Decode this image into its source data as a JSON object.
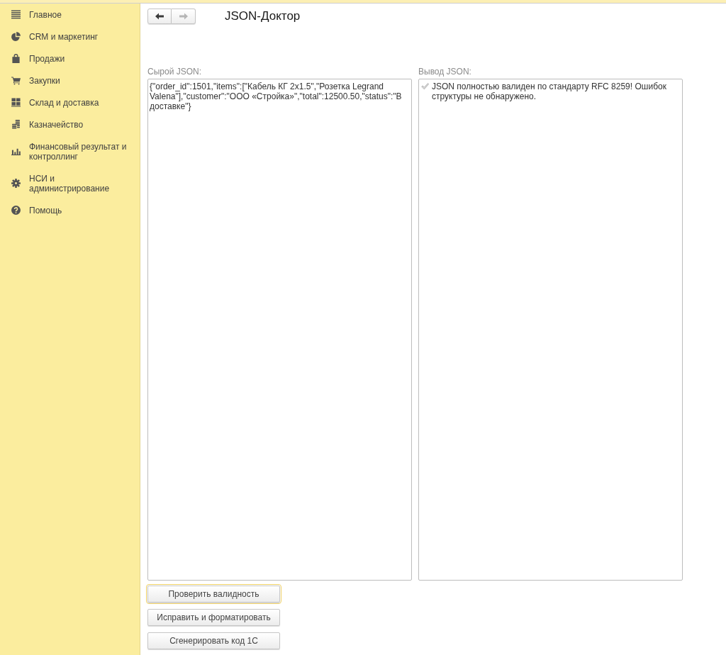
{
  "sidebar": {
    "items": [
      {
        "label": "Главное"
      },
      {
        "label": "CRM и маркетинг"
      },
      {
        "label": "Продажи"
      },
      {
        "label": "Закупки"
      },
      {
        "label": "Склад и доставка"
      },
      {
        "label": "Казначейство"
      },
      {
        "label": "Финансовый результат и контроллинг"
      },
      {
        "label": "НСИ и администрирование"
      },
      {
        "label": "Помощь"
      }
    ]
  },
  "toolbar": {
    "nav_buttons": [
      {
        "kind": "back",
        "disabled": false
      },
      {
        "kind": "forward",
        "disabled": true
      }
    ],
    "title": "JSON-Доктор"
  },
  "input_panel": {
    "label": "Сырой JSON:",
    "value": "{\"order_id\":1501,\"items\":[\"Кабель КГ 2x1.5\",\"Розетка Legrand Valena\"],\"customer\":\"ООО «Стройка»\",\"total\":12500.50,\"status\":\"В доставке\"}"
  },
  "output_panel": {
    "label": "Вывод JSON:",
    "value": "JSON полностью валиден по стандарту RFC 8259! Ошибок структуры не обнаружено."
  },
  "buttons": [
    {
      "label": "Проверить валидность",
      "focused": true
    },
    {
      "label": "Исправить и форматировать",
      "focused": false
    },
    {
      "label": "Сгенерировать код 1С",
      "focused": false
    }
  ]
}
